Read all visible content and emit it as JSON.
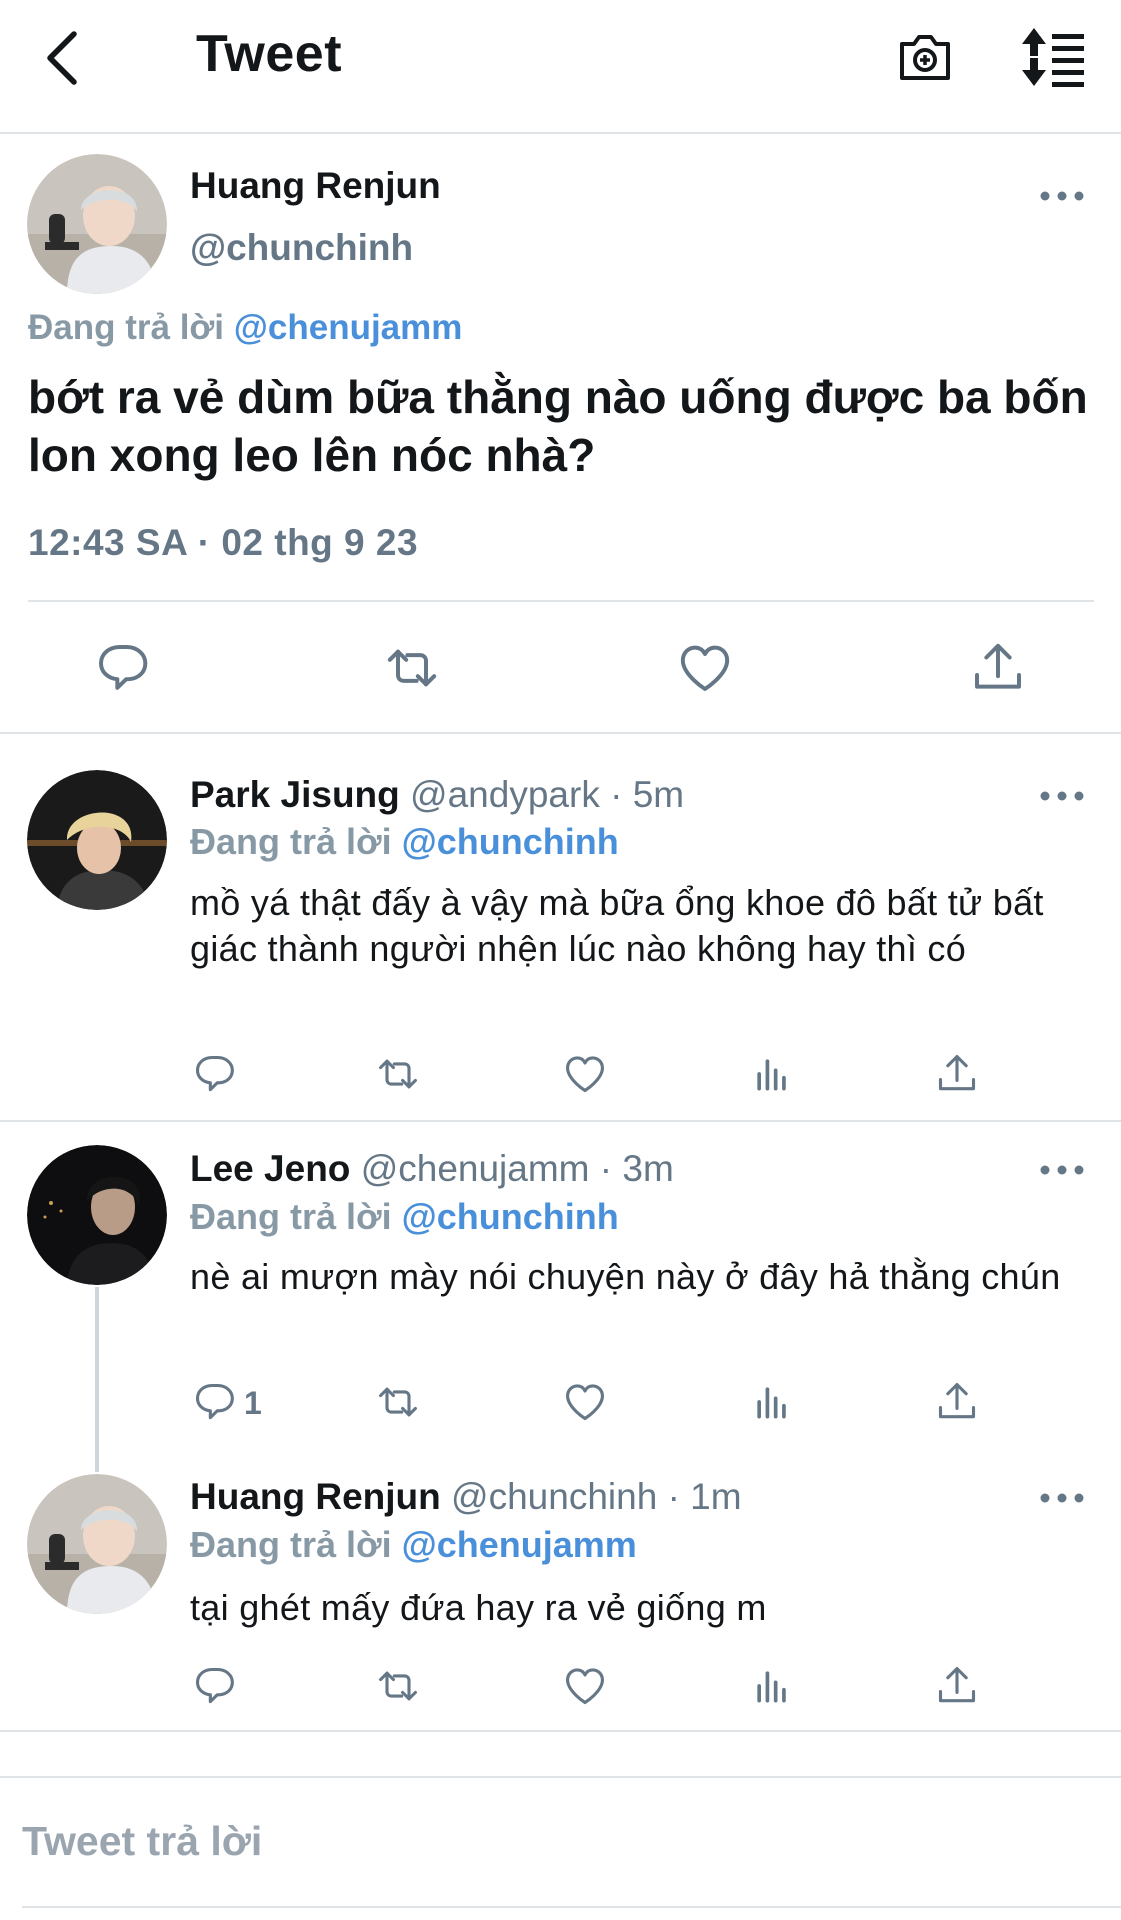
{
  "header": {
    "title": "Tweet",
    "back_icon": "chevron-left-icon",
    "camera_icon": "camera-plus-icon",
    "sort_icon": "sort-list-icon"
  },
  "colors": {
    "mention": "#4a8fd9",
    "secondary_text": "#657786",
    "divider": "#e1e4e6"
  },
  "main_tweet": {
    "name": "Huang Renjun",
    "handle": "@chunchinh",
    "reply_prefix": "Đang trả lời",
    "reply_mention": "@chenujamm",
    "text": "bớt ra vẻ dùm bữa thằng nào uống được ba bốn lon xong leo lên nóc nhà?",
    "timestamp": "12:43 SA · 02 thg 9 23"
  },
  "replies": [
    {
      "name": "Park Jisung",
      "handle_time": "@andypark · 5m",
      "reply_prefix": "Đang trả lời",
      "reply_mention": "@chunchinh",
      "text": "mồ yá thật đấy à vậy mà bữa ổng khoe đô bất tử bất giác thành người nhện lúc nào không hay thì có",
      "reply_count": ""
    },
    {
      "name": "Lee Jeno",
      "handle_time": "@chenujamm · 3m",
      "reply_prefix": "Đang trả lời",
      "reply_mention": "@chunchinh",
      "text": "nè ai mượn mày nói chuyện này ở đây hả thằng chún",
      "reply_count": "1"
    },
    {
      "name": "Huang Renjun",
      "handle_time": "@chunchinh · 1m",
      "reply_prefix": "Đang trả lời",
      "reply_mention": "@chenujamm",
      "text": "tại ghét mấy đứa hay ra vẻ giống m",
      "reply_count": ""
    }
  ],
  "compose": {
    "placeholder": "Tweet trả lời"
  }
}
